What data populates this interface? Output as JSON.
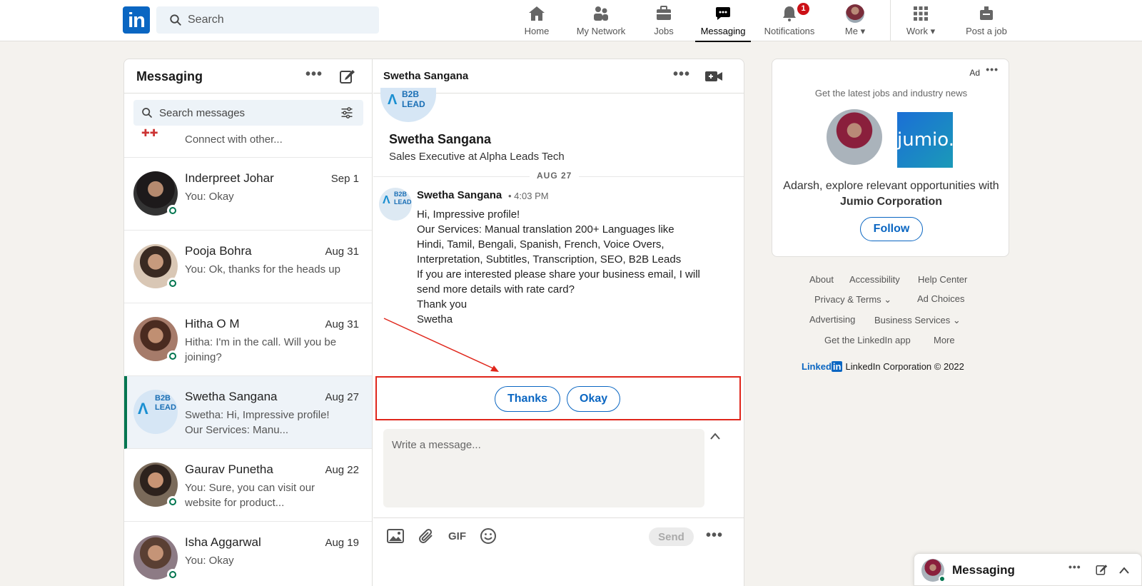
{
  "nav": {
    "logo": "in",
    "search_placeholder": "Search",
    "items": [
      {
        "label": "Home",
        "icon": "home-icon"
      },
      {
        "label": "My Network",
        "icon": "people-icon"
      },
      {
        "label": "Jobs",
        "icon": "briefcase-icon"
      },
      {
        "label": "Messaging",
        "icon": "messaging-icon",
        "active": true
      },
      {
        "label": "Notifications",
        "icon": "bell-icon",
        "badge": "1"
      },
      {
        "label": "Me",
        "icon": "avatar"
      },
      {
        "label": "Work",
        "icon": "grid-icon"
      },
      {
        "label": "Post a job",
        "icon": "post-job-icon"
      }
    ]
  },
  "sidebar": {
    "title": "Messaging",
    "search_placeholder": "Search messages",
    "partial_preview": "Connect with other...",
    "conversations": [
      {
        "name": "Inderpreet Johar",
        "date": "Sep 1",
        "preview": "You: Okay"
      },
      {
        "name": "Pooja Bohra",
        "date": "Aug 31",
        "preview": "You: Ok, thanks for the heads up"
      },
      {
        "name": "Hitha O M",
        "date": "Aug 31",
        "preview": "Hitha: I'm in the call. Will you be joining?"
      },
      {
        "name": "Swetha Sangana",
        "date": "Aug 27",
        "preview": "Swetha: Hi, Impressive profile! Our Services: Manu..."
      },
      {
        "name": "Gaurav Punetha",
        "date": "Aug 22",
        "preview": "You: Sure, you can visit our website for product..."
      },
      {
        "name": "Isha Aggarwal",
        "date": "Aug 19",
        "preview": "You: Okay"
      }
    ]
  },
  "chat": {
    "header_name": "Swetha Sangana",
    "profile_name": "Swetha Sangana",
    "profile_title": "Sales Executive at Alpha Leads Tech",
    "date_separator": "AUG 27",
    "message": {
      "sender": "Swetha Sangana",
      "time": "• 4:03 PM",
      "lines": [
        "Hi, Impressive profile!",
        "Our Services: Manual translation 200+ Languages like Hindi, Tamil, Bengali, Spanish, French, Voice Overs, Interpretation, Subtitles, Transcription, SEO, B2B Leads",
        "If you are interested please share your business email, I will send more details with rate card?",
        "Thank you",
        "Swetha"
      ]
    },
    "quick_replies": [
      "Thanks",
      "Okay"
    ],
    "compose_placeholder": "Write a message...",
    "gif_label": "GIF",
    "send_label": "Send",
    "avatar_text": "B2B LEAD"
  },
  "ad": {
    "label": "Ad",
    "subtitle": "Get the latest jobs and industry news",
    "brand_logo": "jumio.",
    "text_prefix": "Adarsh, explore relevant opportunities with ",
    "company": "Jumio Corporation",
    "follow_label": "Follow"
  },
  "footer": {
    "links": [
      "About",
      "Accessibility",
      "Help Center",
      "Privacy & Terms",
      "Ad Choices",
      "Advertising",
      "Business Services",
      "Get the LinkedIn app",
      "More"
    ],
    "brand": "Linked",
    "brand_in": "in",
    "copyright": "LinkedIn Corporation © 2022"
  },
  "floating": {
    "title": "Messaging"
  },
  "colors": {
    "linkedin_blue": "#0a66c2",
    "online_green": "#01754f",
    "annotation_red": "#e0261b"
  }
}
